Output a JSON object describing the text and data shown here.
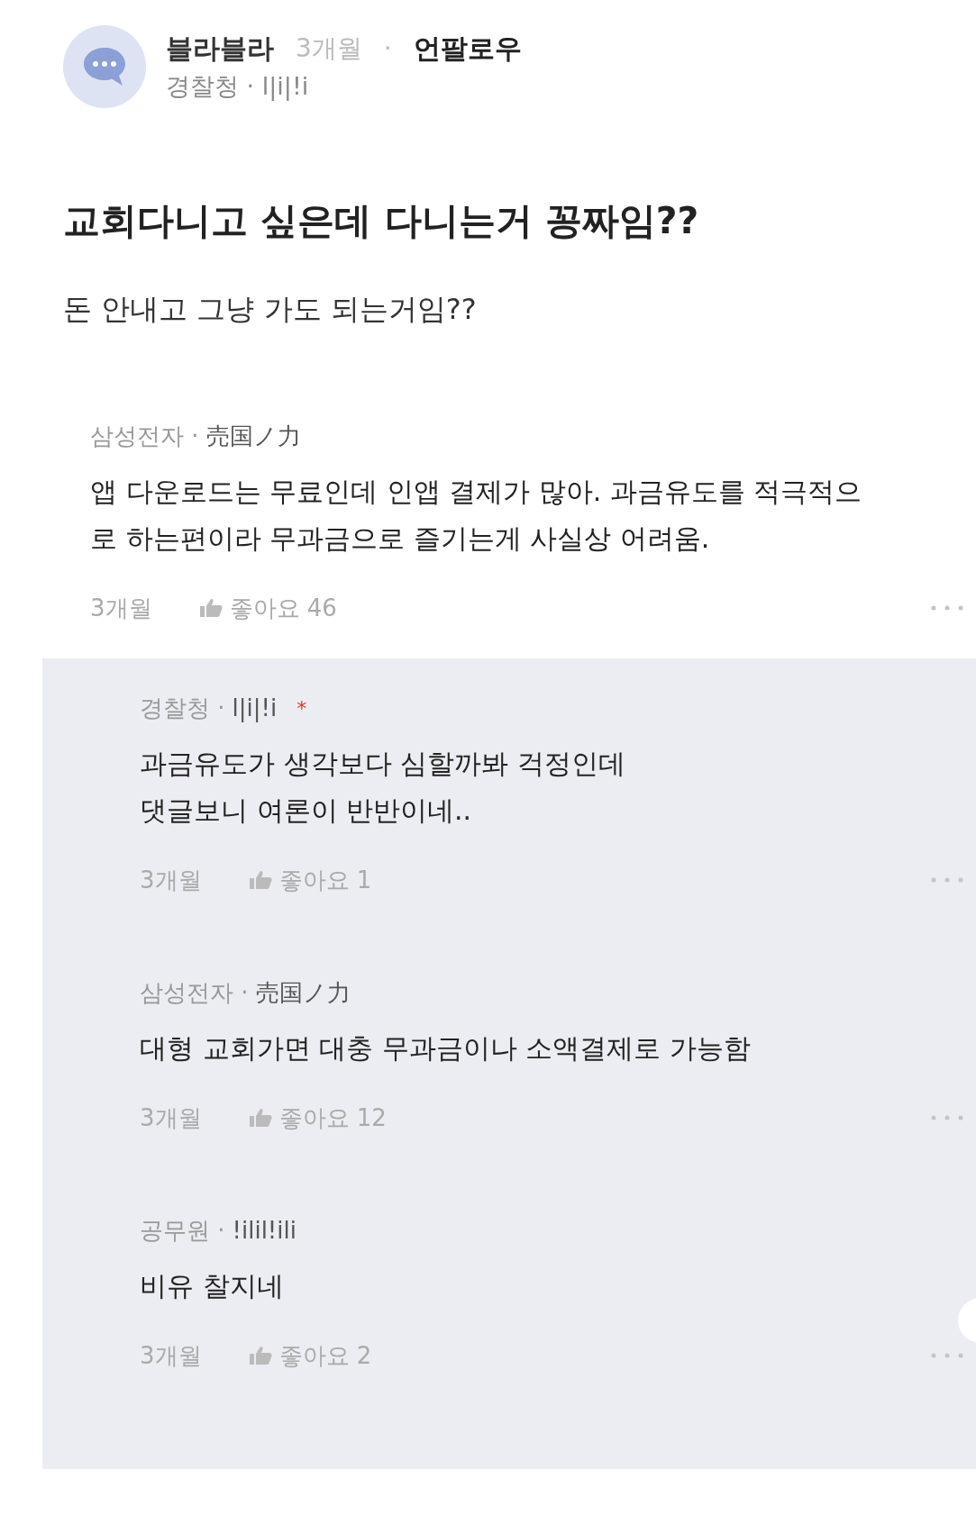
{
  "post": {
    "author": "블라블라",
    "time": "3개월",
    "separator": "·",
    "follow": "언팔로우",
    "meta": "경찰청 · l|i|!i",
    "title": "교회다니고 싶은데 다니는거 꽁짜임??",
    "body": "돈 안내고 그냥 가도 되는거임??"
  },
  "comment": {
    "company": "삼성전자 ·",
    "nickname": "売国ノ力",
    "lines": [
      "앱 다운로드는 무료인데 인앱 결제가 많아. 과금유도를 적극적으",
      "로 하는편이라 무과금으로 즐기는게 사실상 어려움."
    ],
    "time": "3개월",
    "likes": "좋아요 46",
    "replies": [
      {
        "company": "경찰청 ·",
        "nickname": "l|i|!i",
        "author_mark": "*",
        "lines": [
          "과금유도가 생각보다 심할까봐 걱정인데",
          "댓글보니 여론이 반반이네.."
        ],
        "time": "3개월",
        "likes": "좋아요 1"
      },
      {
        "company": "삼성전자 ·",
        "nickname": "売国ノ力",
        "lines": [
          "대형 교회가면 대충 무과금이나 소액결제로 가능함"
        ],
        "time": "3개월",
        "likes": "좋아요 12"
      },
      {
        "company": "공무원 ·",
        "nickname": "!ilil!ili",
        "lines": [
          "비유 찰지네"
        ],
        "time": "3개월",
        "likes": "좋아요 2"
      }
    ]
  }
}
